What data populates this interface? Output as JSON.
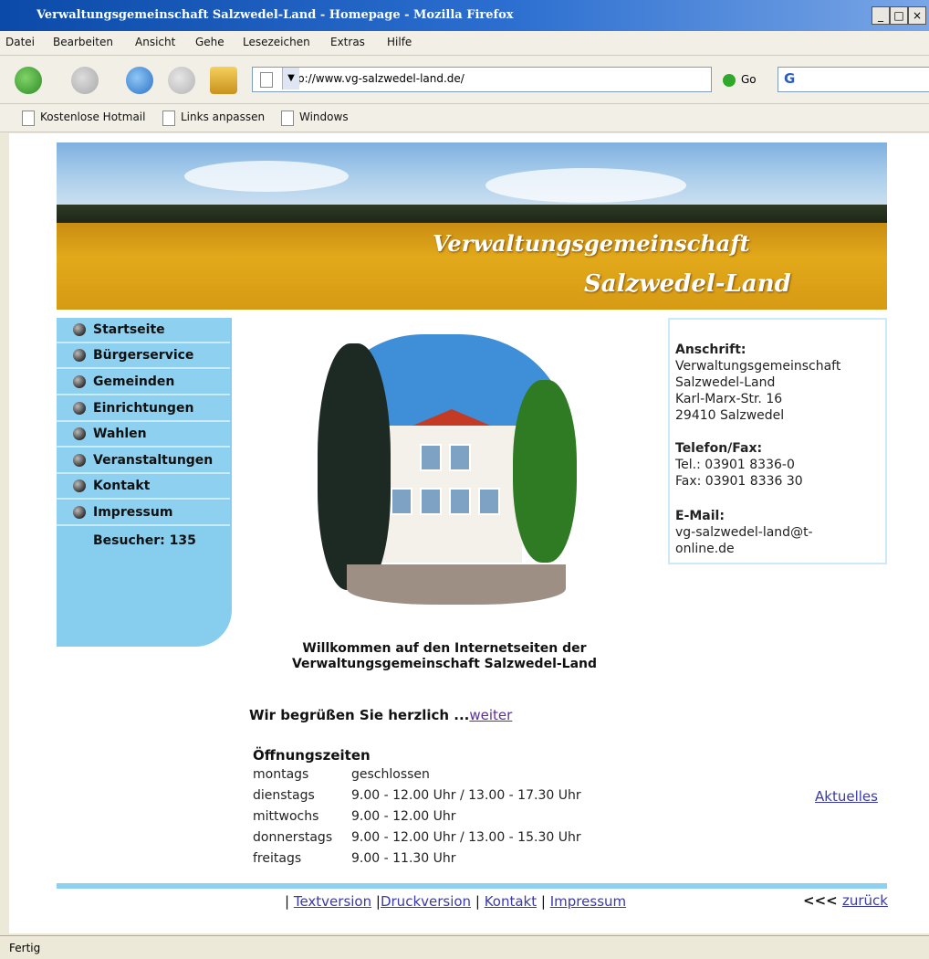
{
  "window": {
    "title": "Verwaltungsgemeinschaft Salzwedel-Land - Homepage - Mozilla Firefox",
    "controls": [
      "_",
      "□",
      "×"
    ]
  },
  "menu": [
    "Datei",
    "Bearbeiten",
    "Ansicht",
    "Gehe",
    "Lesezeichen",
    "Extras",
    "Hilfe"
  ],
  "toolbar": {
    "url": "http://www.vg-salzwedel-land.de/",
    "go_label": "Go",
    "search_glyph": "G"
  },
  "bookmarks": [
    "Kostenlose Hotmail",
    "Links anpassen",
    "Windows"
  ],
  "banner": {
    "line1": "Verwaltungsgemeinschaft",
    "line2": "Salzwedel-Land"
  },
  "nav": {
    "items": [
      "Startseite",
      "Bürgerservice",
      "Gemeinden",
      "Einrichtungen",
      "Wahlen",
      "Veranstaltungen",
      "Kontakt",
      "Impressum"
    ],
    "visitors": "Besucher: 135"
  },
  "address": {
    "heading": "Anschrift:",
    "lines": [
      "Verwaltungsgemeinschaft",
      "Salzwedel-Land",
      "Karl-Marx-Str. 16",
      "29410 Salzwedel"
    ],
    "phone_heading": "Telefon/Fax:",
    "phone": "Tel.: 03901 8336-0",
    "fax": "Fax: 03901 8336 30",
    "email_heading": "E-Mail:",
    "email1": "vg-salzwedel-land@t-",
    "email2": "online.de"
  },
  "welcome": {
    "line1": "Willkommen auf den Internetseiten der",
    "line2": "Verwaltungsgemeinschaft Salzwedel-Land"
  },
  "greeting": {
    "text": "Wir begrüßen Sie herzlich ...",
    "link": "weiter"
  },
  "hours": {
    "heading": "Öffnungszeiten",
    "rows": [
      {
        "day": "montags",
        "time": "geschlossen"
      },
      {
        "day": "dienstags",
        "time": "9.00 - 12.00 Uhr / 13.00 - 17.30 Uhr"
      },
      {
        "day": "mittwochs",
        "time": "9.00 - 12.00 Uhr"
      },
      {
        "day": "donnerstags",
        "time": "9.00 - 12.00 Uhr / 13.00 - 15.30 Uhr"
      },
      {
        "day": "freitags",
        "time": "9.00 - 11.30 Uhr"
      }
    ]
  },
  "aktuelles": "Aktuelles",
  "footer": {
    "sep": "|",
    "links": [
      "Textversion",
      "Druckversion",
      "Kontakt",
      "Impressum"
    ],
    "back_prefix": "<<<",
    "back_link": "zurück"
  },
  "status": "Fertig"
}
